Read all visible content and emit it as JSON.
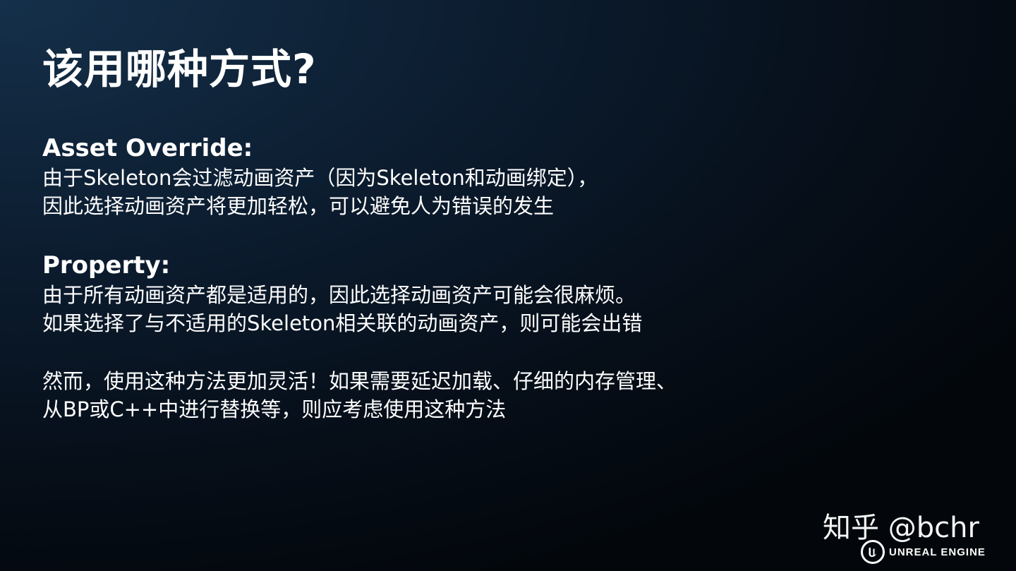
{
  "slide": {
    "title": "该用哪种方式?",
    "sections": [
      {
        "heading": "Asset Override:",
        "lines": [
          "由于Skeleton会过滤动画资产（因为Skeleton和动画绑定），",
          "因此选择动画资产将更加轻松，可以避免人为错误的发生"
        ]
      },
      {
        "heading": "Property:",
        "lines": [
          "由于所有动画资产都是适用的，因此选择动画资产可能会很麻烦。",
          "如果选择了与不适用的Skeleton相关联的动画资产，则可能会出错"
        ]
      },
      {
        "heading": "",
        "lines": [
          "然而，使用这种方法更加灵活！如果需要延迟加载、仔细的内存管理、",
          "从BP或C++中进行替换等，则应考虑使用这种方法"
        ]
      }
    ]
  },
  "watermark": {
    "text": "知乎 @bchr"
  },
  "brand": {
    "logo_icon": "unreal-engine-logo-icon",
    "name": "UNREAL ENGINE"
  },
  "colors": {
    "background_top_left": "#15304a",
    "background_bottom_right": "#03070c",
    "text": "#ffffff"
  }
}
